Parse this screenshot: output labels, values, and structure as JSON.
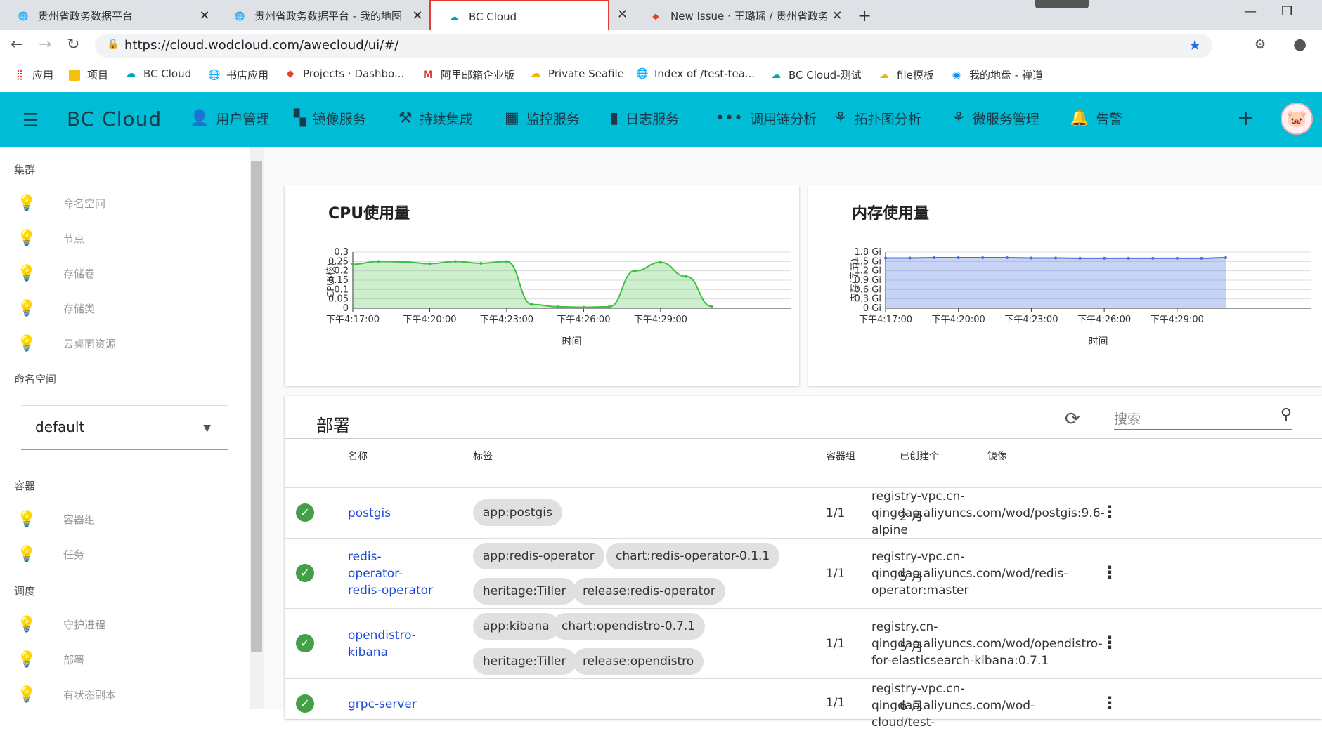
{
  "browser": {
    "tabs": [
      {
        "title": "贵州省政务数据平台",
        "icon": "globe-icon"
      },
      {
        "title": "贵州省政务数据平台 - 我的地图",
        "icon": "globe-icon"
      },
      {
        "title": "BC Cloud",
        "icon": "cloud-icon"
      },
      {
        "title": "New Issue · 王璐瑶 / 贵州省政务",
        "icon": "gitlab-icon"
      }
    ],
    "url": "https://cloud.wodcloud.com/awecloud/ui/#/",
    "bookmarks": [
      "应用",
      "项目",
      "BC Cloud",
      "书店应用",
      "Projects · Dashbo...",
      "阿里邮箱企业版",
      "Private Seafile",
      "Index of /test-tea...",
      "BC Cloud-测试",
      "file模板",
      "我的地盘 - 禅道"
    ]
  },
  "app": {
    "brand": "BC  Cloud",
    "nav": [
      "用户管理",
      "镜像服务",
      "持续集成",
      "监控服务",
      "日志服务",
      "调用链分析",
      "拓扑图分析",
      "微服务管理",
      "告警"
    ]
  },
  "sidebar": {
    "sections": [
      {
        "title": "集群",
        "items": [
          "命名空间",
          "节点",
          "存储卷",
          "存储类",
          "云桌面资源"
        ]
      },
      {
        "title": "命名空间"
      },
      {
        "title": "容器",
        "items": [
          "容器组",
          "任务"
        ]
      },
      {
        "title": "调度",
        "items": [
          "守护进程",
          "部署",
          "有状态副本"
        ]
      }
    ],
    "namespace_value": "default"
  },
  "charts": {
    "cpu": {
      "title": "CPU使用量",
      "ylabel": "CPU(核)",
      "xlabel": "时间"
    },
    "mem": {
      "title": "内存使用量",
      "ylabel": "内存(字节)",
      "xlabel": "时间"
    }
  },
  "chart_data": [
    {
      "type": "area",
      "title": "CPU使用量",
      "xlabel": "时间",
      "ylabel": "CPU(核)",
      "ylim": [
        0,
        0.3
      ],
      "yticks": [
        "0",
        "0.05",
        "0.1",
        "0.15",
        "0.2",
        "0.25",
        "0.3"
      ],
      "xticks": [
        "下午4:17:00",
        "下午4:20:00",
        "下午4:23:00",
        "下午4:26:00",
        "下午4:29:00"
      ],
      "x": [
        "4:17:00",
        "4:18:00",
        "4:19:00",
        "4:20:00",
        "4:21:00",
        "4:22:00",
        "4:23:00",
        "4:24:00",
        "4:25:00",
        "4:26:00",
        "4:27:00",
        "4:28:00",
        "4:29:00",
        "4:30:00",
        "4:31:00"
      ],
      "series": [
        {
          "values": [
            0.235,
            0.25,
            0.248,
            0.238,
            0.25,
            0.24,
            0.25,
            0.02,
            0.008,
            0.005,
            0.008,
            0.2,
            0.245,
            0.17,
            0.01
          ],
          "color": "#3cc13c"
        }
      ],
      "grid": true
    },
    {
      "type": "area",
      "title": "内存使用量",
      "xlabel": "时间",
      "ylabel": "内存(字节)",
      "ylim": [
        0,
        1.8
      ],
      "yticks": [
        "0 Gi",
        "0.3 Gi",
        "0.6 Gi",
        "0.9 Gi",
        "1.2 Gi",
        "1.5 Gi",
        "1.8 Gi"
      ],
      "xticks": [
        "下午4:17:00",
        "下午4:20:00",
        "下午4:23:00",
        "下午4:26:00",
        "下午4:29:00"
      ],
      "x": [
        "4:17:00",
        "4:18:00",
        "4:19:00",
        "4:20:00",
        "4:21:00",
        "4:22:00",
        "4:23:00",
        "4:24:00",
        "4:25:00",
        "4:26:00",
        "4:27:00",
        "4:28:00",
        "4:29:00",
        "4:30:00",
        "4:31:00"
      ],
      "series": [
        {
          "values": [
            1.61,
            1.61,
            1.62,
            1.62,
            1.62,
            1.62,
            1.61,
            1.61,
            1.6,
            1.6,
            1.6,
            1.6,
            1.6,
            1.6,
            1.62
          ],
          "color": "#4a6fe0"
        }
      ],
      "grid": true
    }
  ],
  "deploy": {
    "title": "部署",
    "search_placeholder": "搜索",
    "columns": [
      "名称",
      "标签",
      "容器组",
      "已创建个",
      "镜像"
    ],
    "rows": [
      {
        "name": [
          "postgis"
        ],
        "labels": [
          "app:postgis"
        ],
        "pods": "1/1",
        "age": "2 月",
        "image": [
          "registry-vpc.cn-",
          "qingdao.aliyuncs.com/wod/postgis:9.6-",
          "alpine"
        ]
      },
      {
        "name": [
          "redis-",
          "operator-",
          "redis-operator"
        ],
        "labels": [
          "app:redis-operator",
          "chart:redis-operator-0.1.1",
          "heritage:Tiller",
          "release:redis-operator"
        ],
        "pods": "1/1",
        "age": "5 月",
        "image": [
          "registry-vpc.cn-",
          "qingdao.aliyuncs.com/wod/redis-",
          "operator:master"
        ]
      },
      {
        "name": [
          "opendistro-",
          "kibana"
        ],
        "labels": [
          "app:kibana",
          "chart:opendistro-0.7.1",
          "heritage:Tiller",
          "release:opendistro"
        ],
        "pods": "1/1",
        "age": "5 月",
        "image": [
          "registry.cn-",
          "qingdao.aliyuncs.com/wod/opendistro-",
          "for-elasticsearch-kibana:0.7.1"
        ]
      },
      {
        "name": [
          "grpc-server"
        ],
        "labels": [],
        "pods": "1/1",
        "age": "6 月",
        "image": [
          "registry-vpc.cn-",
          "qingdao.aliyuncs.com/wod-cloud/test-"
        ]
      }
    ]
  }
}
